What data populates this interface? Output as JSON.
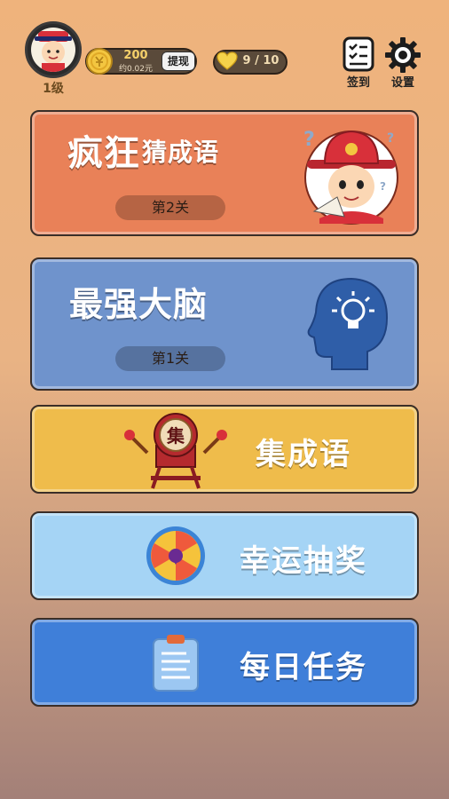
{
  "user": {
    "level_label": "1级"
  },
  "coins": {
    "amount": "200",
    "approx": "约0.02元",
    "withdraw_label": "提现"
  },
  "lives": {
    "text": "9 / 10"
  },
  "top_actions": {
    "checkin_label": "签到",
    "settings_label": "设置"
  },
  "modes": {
    "crazy": {
      "title_a": "疯狂",
      "title_b": "猜成语",
      "stage": "第2关",
      "color": "#e98158"
    },
    "brain": {
      "title": "最强大脑",
      "stage": "第1关",
      "color": "#6f93cc"
    },
    "collect": {
      "label": "集成语",
      "drum_char": "集",
      "color": "#efbc4b"
    },
    "lucky": {
      "label": "幸运抽奖",
      "color": "#a5d4f5"
    },
    "daily": {
      "label": "每日任务",
      "color": "#3f7fd9"
    }
  }
}
